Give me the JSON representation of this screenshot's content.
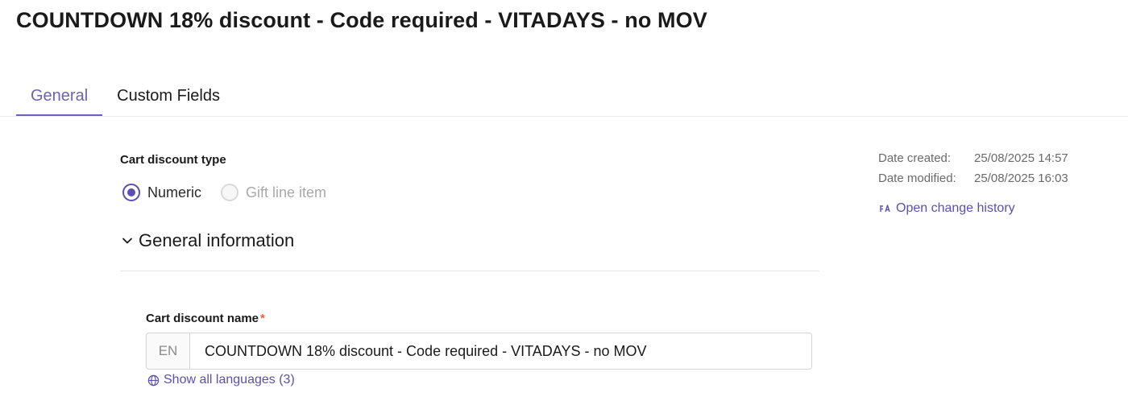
{
  "page": {
    "title": "COUNTDOWN 18% discount - Code required - VITADAYS - no MOV"
  },
  "tabs": [
    {
      "label": "General",
      "active": true
    },
    {
      "label": "Custom Fields",
      "active": false
    }
  ],
  "discount_type": {
    "label": "Cart discount type",
    "options": [
      {
        "label": "Numeric",
        "checked": true,
        "disabled": false
      },
      {
        "label": "Gift line item",
        "checked": false,
        "disabled": true
      }
    ]
  },
  "general_info": {
    "title": "General information",
    "expanded": true,
    "name_field": {
      "label": "Cart discount name",
      "required_marker": "*",
      "lang_prefix": "EN",
      "value": "COUNTDOWN 18% discount - Code required - VITADAYS - no MOV"
    },
    "show_languages_link": "Show all languages (3)"
  },
  "meta": {
    "date_created_label": "Date created:",
    "date_created_value": "25/08/2025 14:57",
    "date_modified_label": "Date modified:",
    "date_modified_value": "25/08/2025 16:03",
    "history_link": "Open change history"
  },
  "colors": {
    "accent": "#5b50b0",
    "tab_active": "#6e63b3",
    "required": "#e8614a"
  },
  "icons": {
    "collapse": "chevron-down-icon",
    "languages": "globe-icon",
    "history": "history-icon"
  }
}
